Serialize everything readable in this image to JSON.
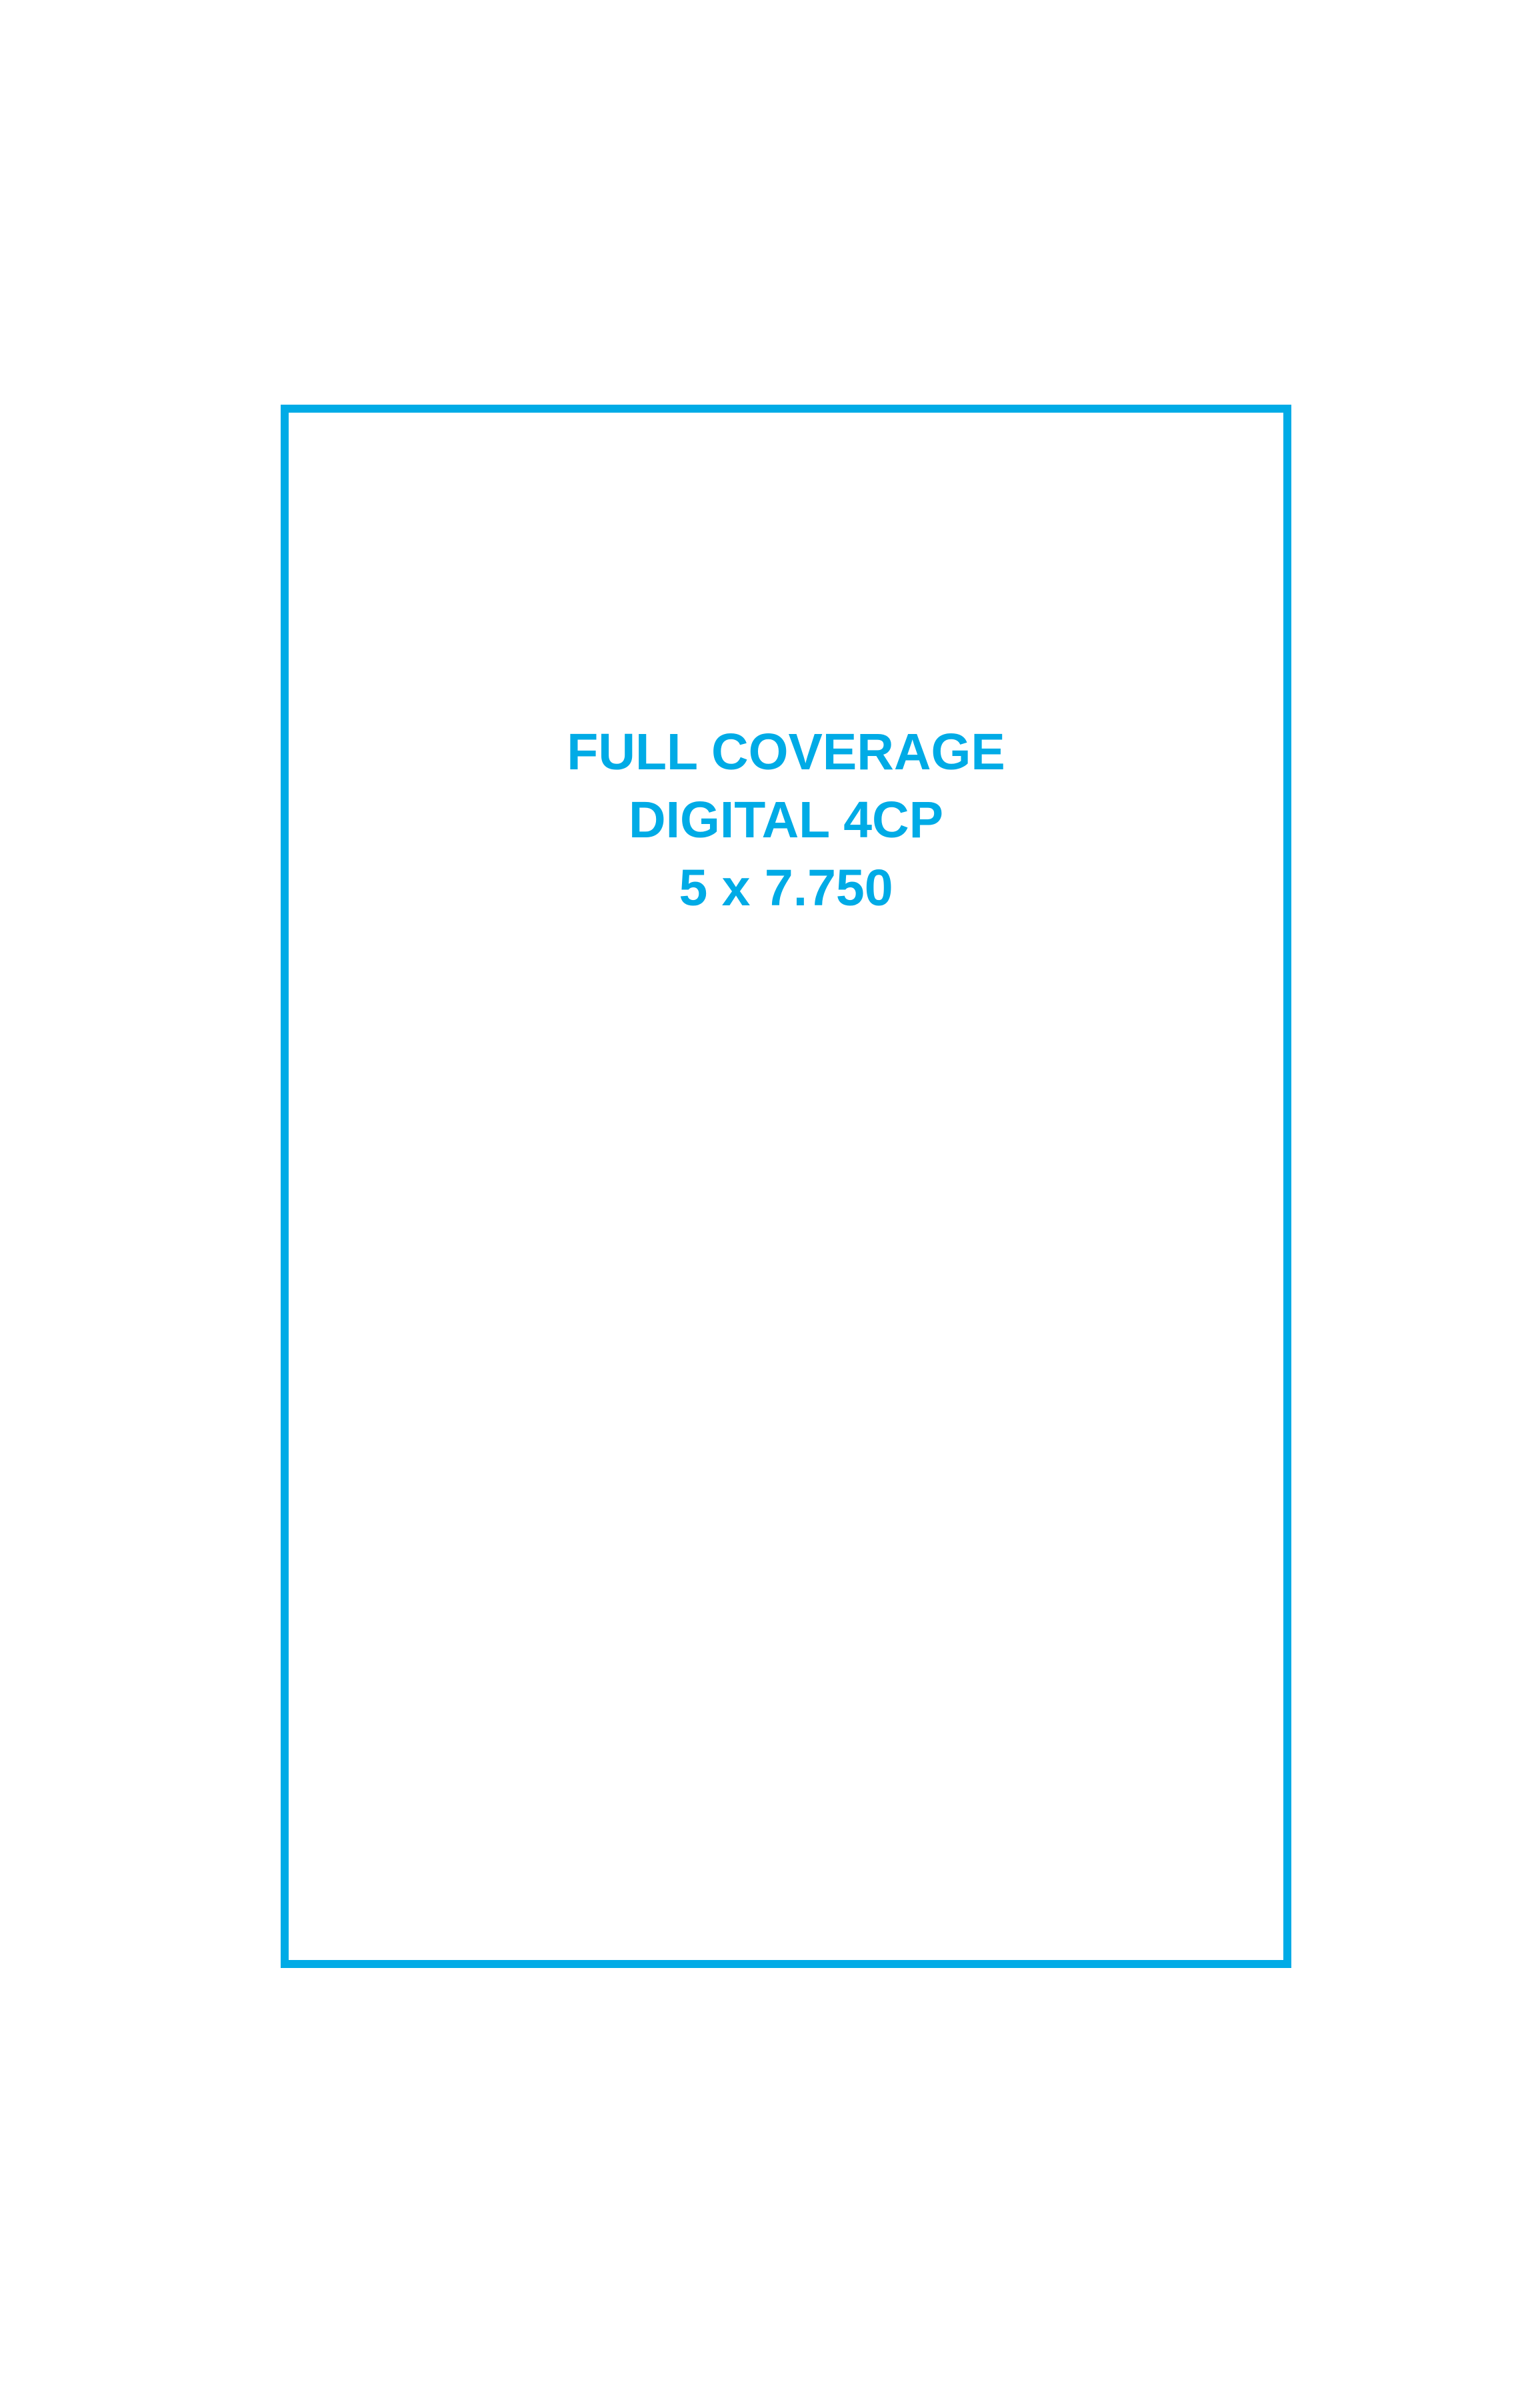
{
  "ad_spec": {
    "line1": "FULL COVERAGE",
    "line2": "DIGITAL 4CP",
    "line3": "5 x 7.750"
  },
  "colors": {
    "frame": "#00abe6",
    "text": "#00abe6",
    "background": "#ffffff"
  }
}
